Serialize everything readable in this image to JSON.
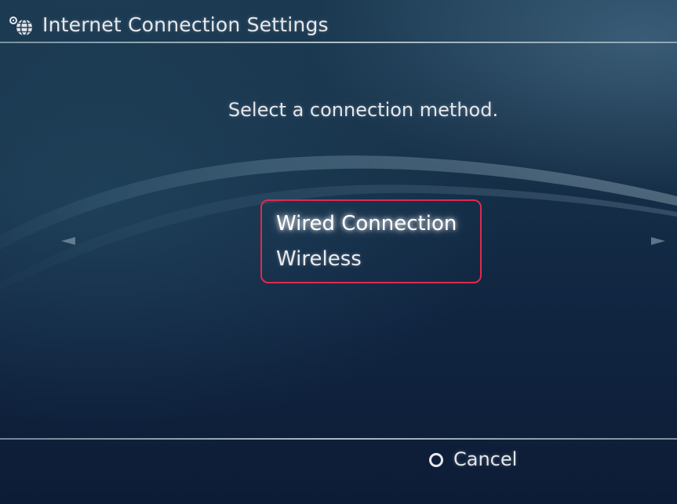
{
  "header": {
    "title": "Internet Connection Settings",
    "icon": "globe-settings-icon"
  },
  "main": {
    "prompt": "Select a connection method.",
    "options": [
      {
        "label": "Wired Connection",
        "selected": true
      },
      {
        "label": "Wireless",
        "selected": false
      }
    ],
    "highlight_color": "#e0294f"
  },
  "footer": {
    "cancel_icon": "circle-button-icon",
    "cancel_label": "Cancel"
  }
}
